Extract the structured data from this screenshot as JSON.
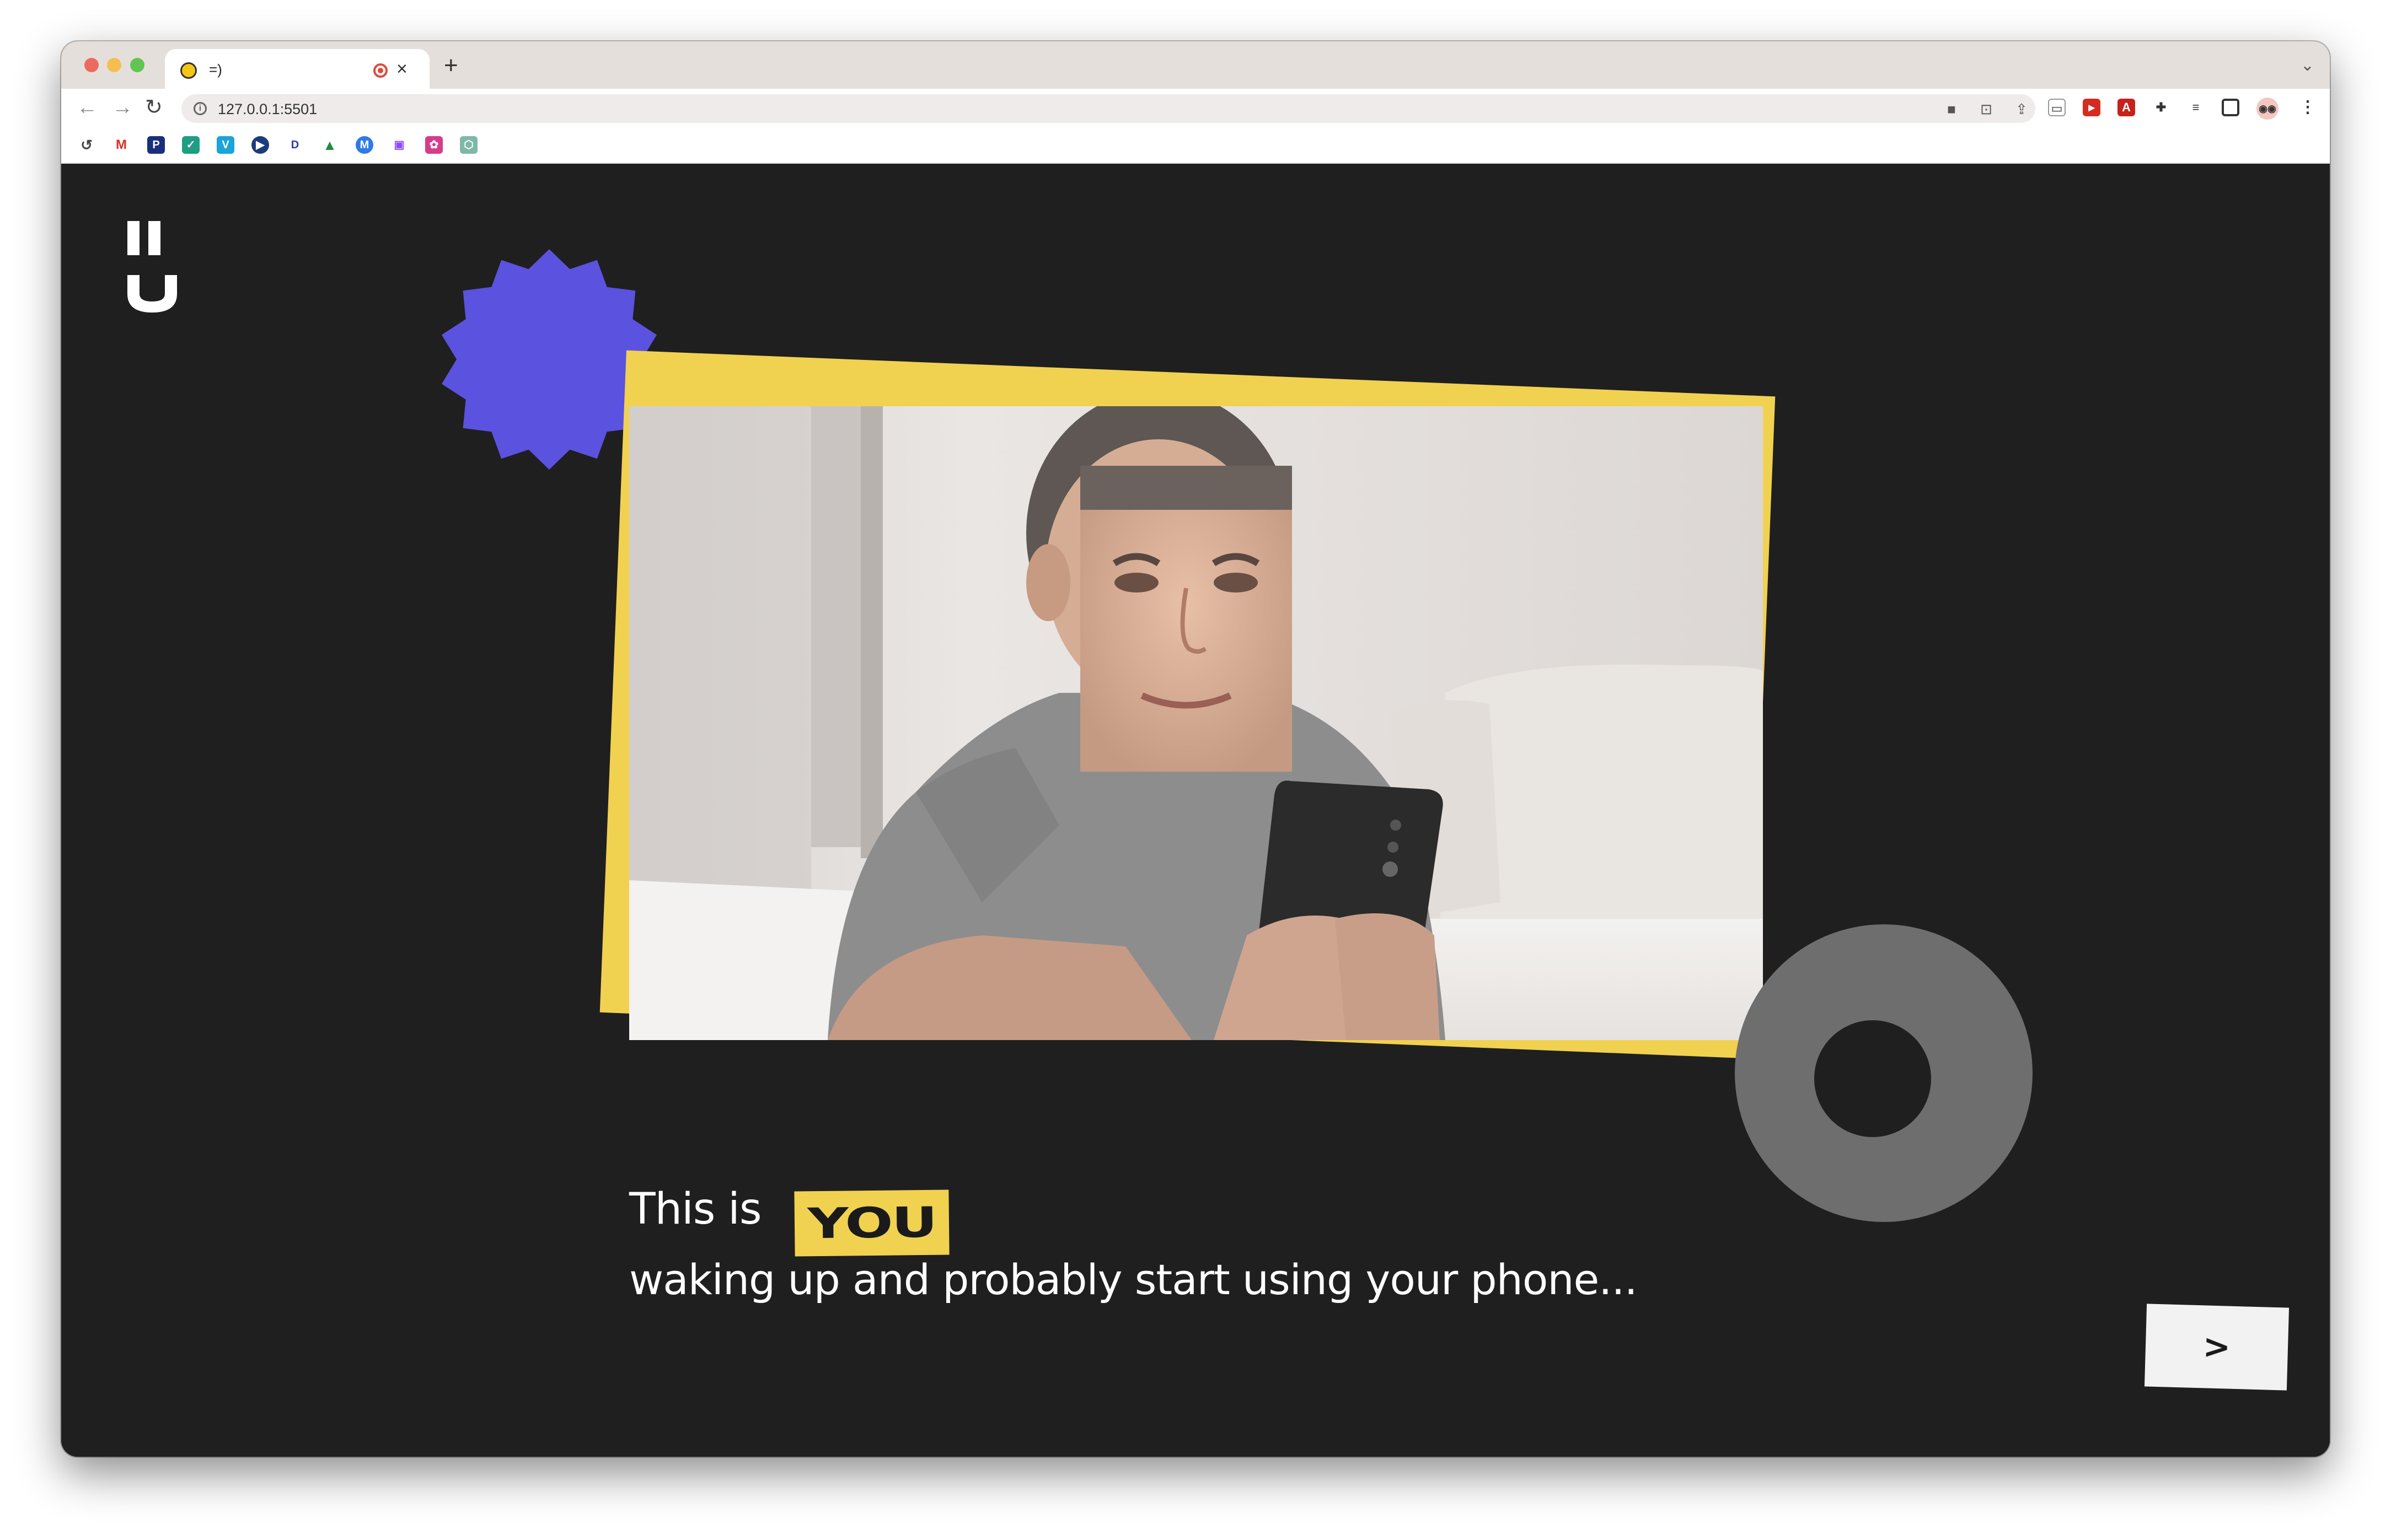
{
  "browser": {
    "tab": {
      "title": "=)",
      "favicon": "smiley-face-icon",
      "recording_indicator": "record-icon"
    },
    "address_bar": {
      "url": "127.0.0.1:5501"
    },
    "toolbar_icons": [
      "camera-icon",
      "translate-icon",
      "share-icon",
      "star-icon"
    ],
    "extensions": [
      "cast-icon",
      "youtube-ext-icon",
      "pdf-ext-icon",
      "puzzle-extensions-icon",
      "reading-list-icon",
      "sidepanel-icon",
      "profile-avatar",
      "more-menu-icon"
    ],
    "bookmarks": [
      "history-icon",
      "gmail-icon",
      "p-bookmark-icon",
      "check-bookmark-icon",
      "vimeo-icon",
      "play-bookmark-icon",
      "disney-icon",
      "drive-icon",
      "m-bookmark-icon",
      "twitch-icon",
      "flower-bookmark-icon",
      "openai-icon"
    ]
  },
  "page": {
    "logo": "brand-logo",
    "headline": {
      "prefix": "This is",
      "highlight": "YOU"
    },
    "subline": "waking up and probably start using your phone...",
    "next_button": {
      "label": ">"
    },
    "colors": {
      "background": "#1f1f1f",
      "accent_yellow": "#f1d150",
      "accent_purple": "#5b52e0",
      "ring_gray": "#6e6e6e"
    }
  }
}
